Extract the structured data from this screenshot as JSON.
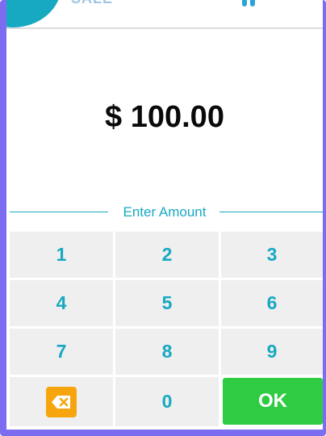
{
  "header": {
    "tab_label": "SALE"
  },
  "amount_display": "$ 100.00",
  "enter_amount_label": "Enter Amount",
  "keypad": {
    "keys": [
      "1",
      "2",
      "3",
      "4",
      "5",
      "6",
      "7",
      "8",
      "9"
    ],
    "zero": "0",
    "ok": "OK",
    "backspace_icon": "backspace-icon"
  },
  "colors": {
    "accent": "#17a9c2",
    "ok_button": "#2ecb43",
    "backspace": "#f7a50f",
    "key_background": "#efefef",
    "frame": "#7b6cf0"
  }
}
